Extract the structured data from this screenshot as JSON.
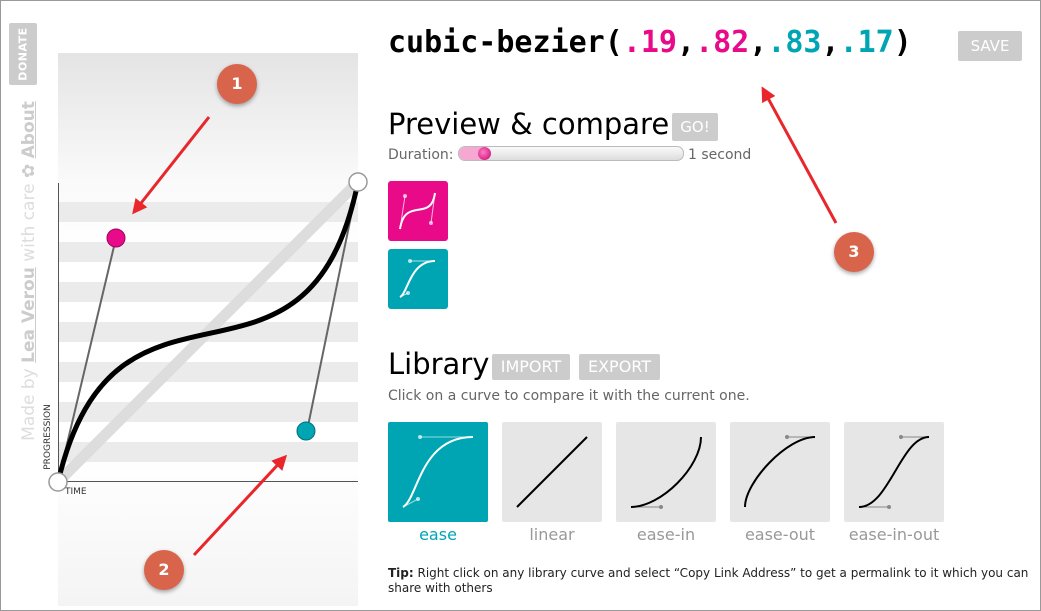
{
  "donate_label": "DONATE",
  "credit": {
    "prefix": "Made by ",
    "author": "Lea Verou",
    "middle": " with care ",
    "star": "✿",
    "about": "About"
  },
  "graph": {
    "y_axis_label": "PROGRESSION",
    "x_axis_label": "TIME",
    "p1": [
      0.19,
      0.82
    ],
    "p2": [
      0.83,
      0.17
    ]
  },
  "title": {
    "open": "cubic-bezier(",
    "v1": ".19",
    "v2": ".82",
    "v3": ".83",
    "v4": ".17",
    "sep": ",",
    "close": ")"
  },
  "save_label": "SAVE",
  "preview": {
    "heading": "Preview & compare",
    "go_label": "GO!",
    "duration_label": "Duration:",
    "duration_value": "1 second",
    "duration_fraction": 0.1
  },
  "library": {
    "heading": "Library",
    "import_label": "IMPORT",
    "export_label": "EXPORT",
    "hint": "Click on a curve to compare it with the current one.",
    "items": [
      {
        "label": "ease",
        "selected": true
      },
      {
        "label": "linear",
        "selected": false
      },
      {
        "label": "ease-in",
        "selected": false
      },
      {
        "label": "ease-out",
        "selected": false
      },
      {
        "label": "ease-in-out",
        "selected": false
      }
    ]
  },
  "tip": {
    "bold": "Tip:",
    "text": " Right click on any library curve and select “Copy Link Address” to get a permalink to it which you can share with others"
  },
  "annotations": [
    "1",
    "2",
    "3"
  ],
  "colors": {
    "pink": "#e90a8a",
    "teal": "#00a5b4",
    "badge": "#d9644c",
    "arrow": "#e8262b",
    "button": "#cccccc"
  }
}
